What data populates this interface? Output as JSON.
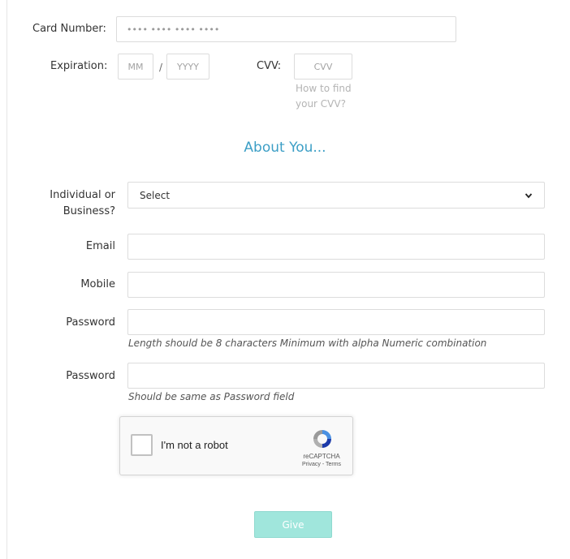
{
  "payment": {
    "card_number_label": "Card Number:",
    "card_number_value": "•••• •••• •••• ••••",
    "expiration_label": "Expiration:",
    "exp_month_placeholder": "MM",
    "exp_separator": "/",
    "exp_year_placeholder": "YYYY",
    "cvv_label": "CVV:",
    "cvv_placeholder": "CVV",
    "cvv_help_line1": "How to find",
    "cvv_help_line2": "your CVV?"
  },
  "about": {
    "title": "About You...",
    "type_label_line1": "Individual or",
    "type_label_line2": "Business?",
    "type_selected": "Select",
    "email_label": "Email",
    "mobile_label": "Mobile",
    "password_label": "Password",
    "password_hint": "Length should be 8 characters Minimum with alpha Numeric combination",
    "confirm_password_label": "Password",
    "confirm_password_hint": "Should be same as Password field"
  },
  "captcha": {
    "label": "I'm not a robot",
    "brand": "reCAPTCHA",
    "links": "Privacy - Terms"
  },
  "submit": {
    "label": "Give"
  },
  "colors": {
    "accent_title": "#3d9fc6",
    "button": "#a0e6dc"
  },
  "icons": [
    "chevron-down-icon",
    "recaptcha-logo-icon"
  ]
}
